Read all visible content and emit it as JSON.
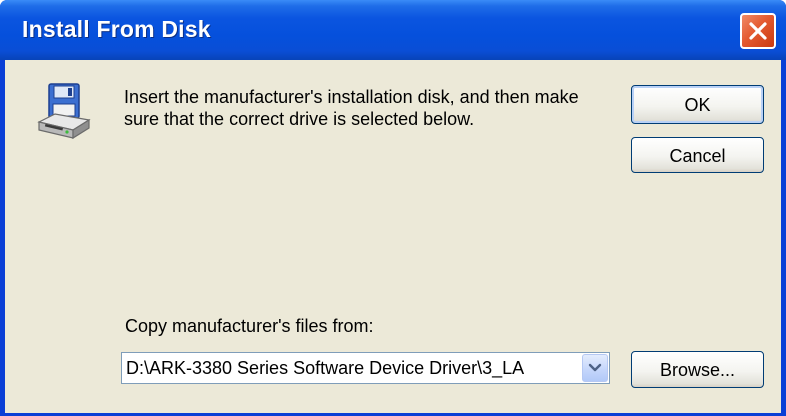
{
  "dialog": {
    "title": "Install From Disk",
    "message": "Insert the manufacturer's installation disk, and then make sure that the correct drive is selected below.",
    "ok_label": "OK",
    "cancel_label": "Cancel",
    "copy_label": "Copy manufacturer's files from:",
    "path_value": "D:\\ARK-3380 Series Software Device Driver\\3_LA",
    "browse_label": "Browse...",
    "icons": {
      "close": "close-icon",
      "disk": "floppy-disk-drive-icon",
      "dropdown": "chevron-down-icon"
    },
    "colors": {
      "titlebar": "#0550dc",
      "client": "#ece9d8",
      "close": "#e45a30"
    }
  }
}
